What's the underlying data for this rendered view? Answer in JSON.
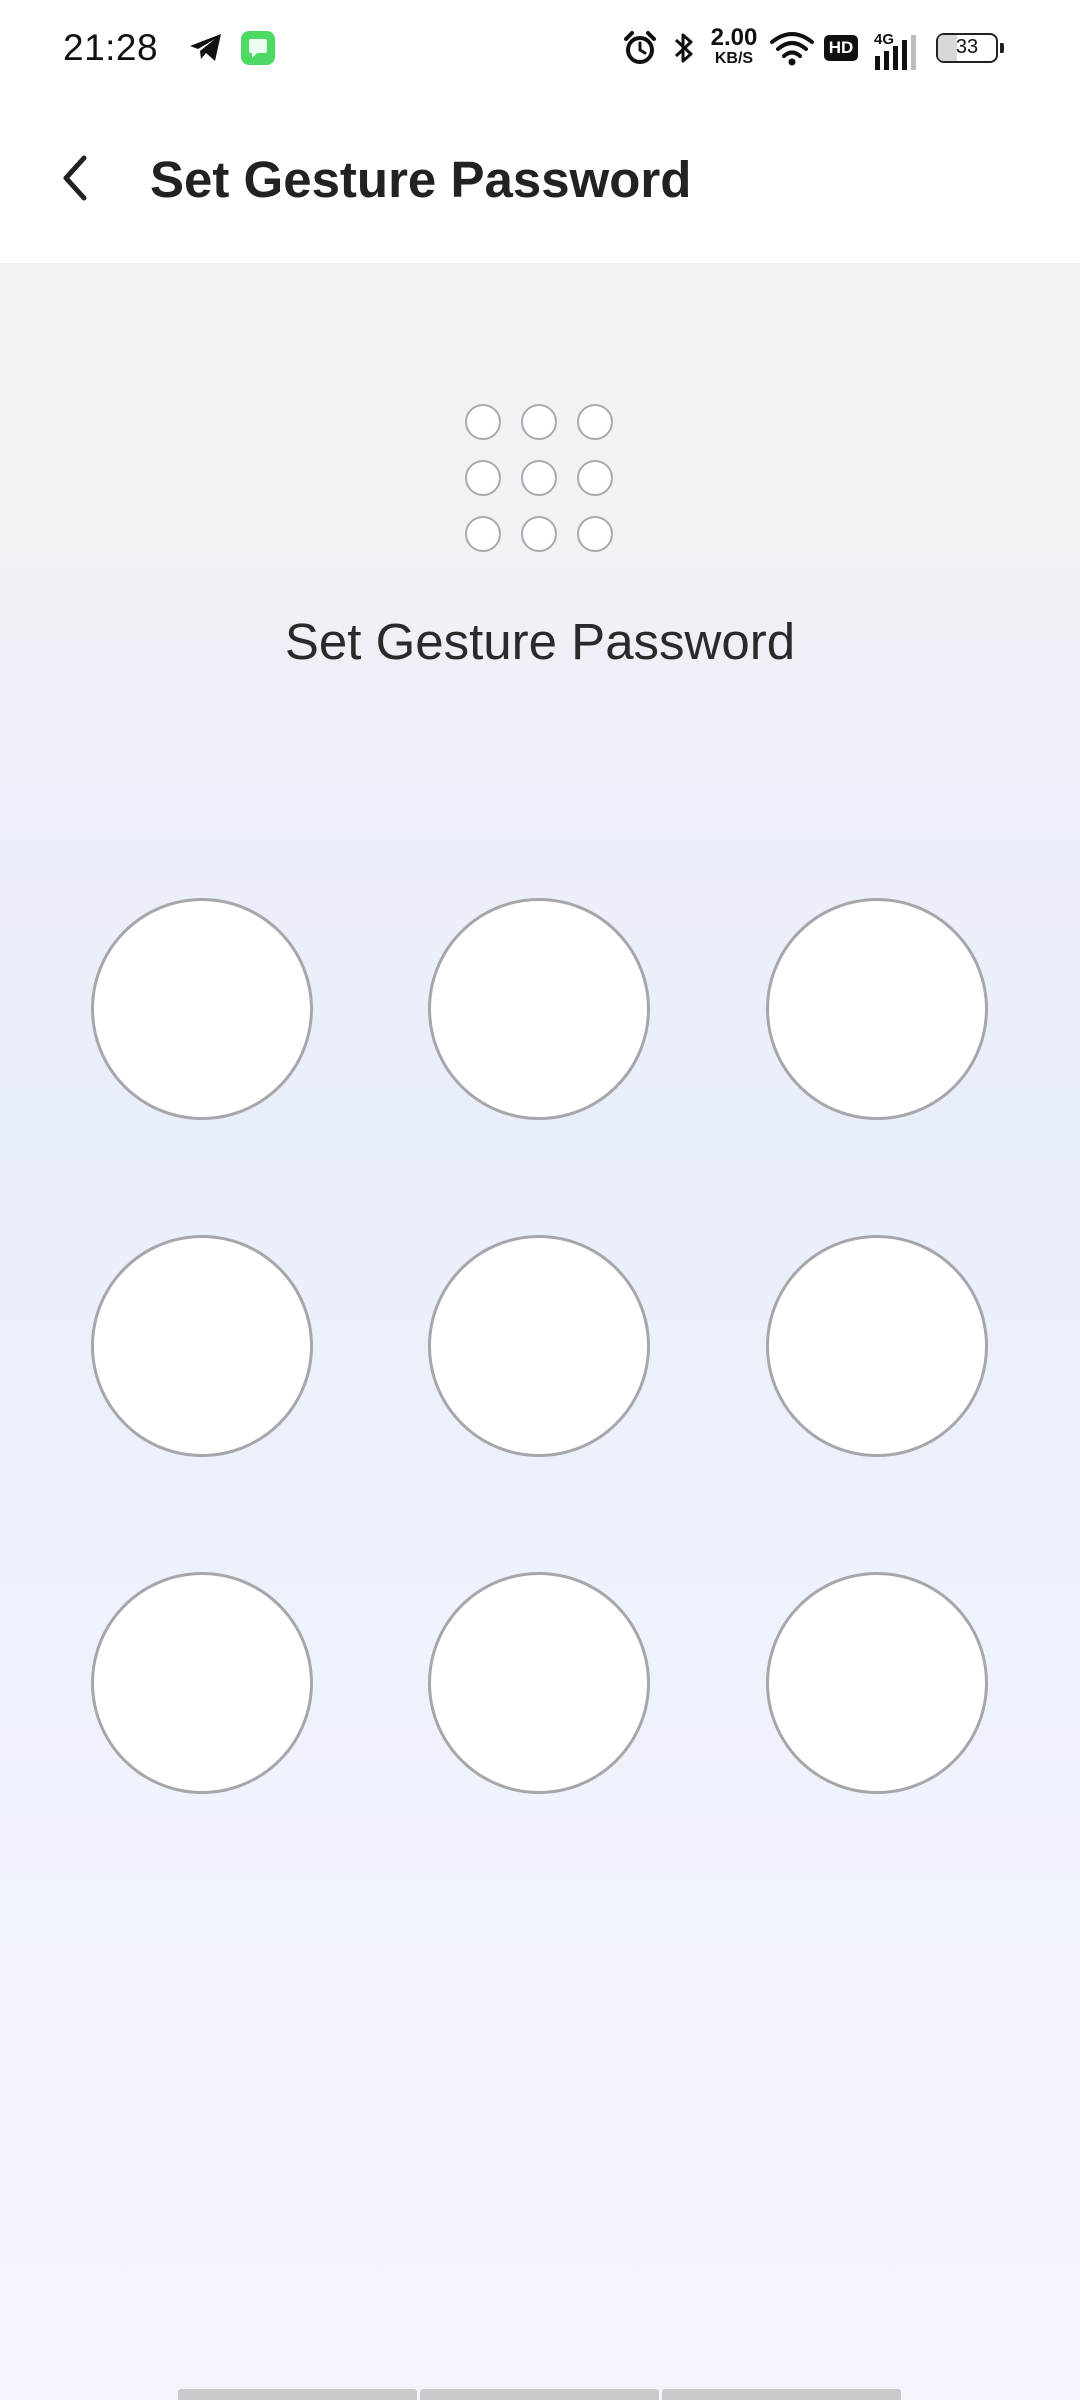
{
  "status_bar": {
    "time": "21:28",
    "net_speed_value": "2.00",
    "net_speed_unit": "KB/S",
    "network_type": "4G",
    "hd_label": "HD",
    "battery_level": "33",
    "battery_fraction": 0.33,
    "icons": [
      "telegram-icon",
      "messages-app-icon",
      "alarm-icon",
      "bluetooth-icon",
      "wifi-icon",
      "hd-icon",
      "signal-icon",
      "battery-icon"
    ],
    "colors": {
      "messages_app": "#4cd964"
    }
  },
  "header": {
    "back_icon": "chevron-left-icon",
    "title": "Set Gesture Password"
  },
  "gesture_preview": {
    "rows": 3,
    "cols": 3
  },
  "prompt": {
    "text": "Set Gesture Password"
  },
  "gesture_pad": {
    "rows": 3,
    "cols": 3,
    "nodes": [
      "node-1",
      "node-2",
      "node-3",
      "node-4",
      "node-5",
      "node-6",
      "node-7",
      "node-8",
      "node-9"
    ]
  },
  "colors": {
    "node_border": "#a6a6ab",
    "node_fill": "#ffffff",
    "background_top": "#f5f2f4",
    "background_mid": "#e9eefb",
    "text": "#222222"
  }
}
